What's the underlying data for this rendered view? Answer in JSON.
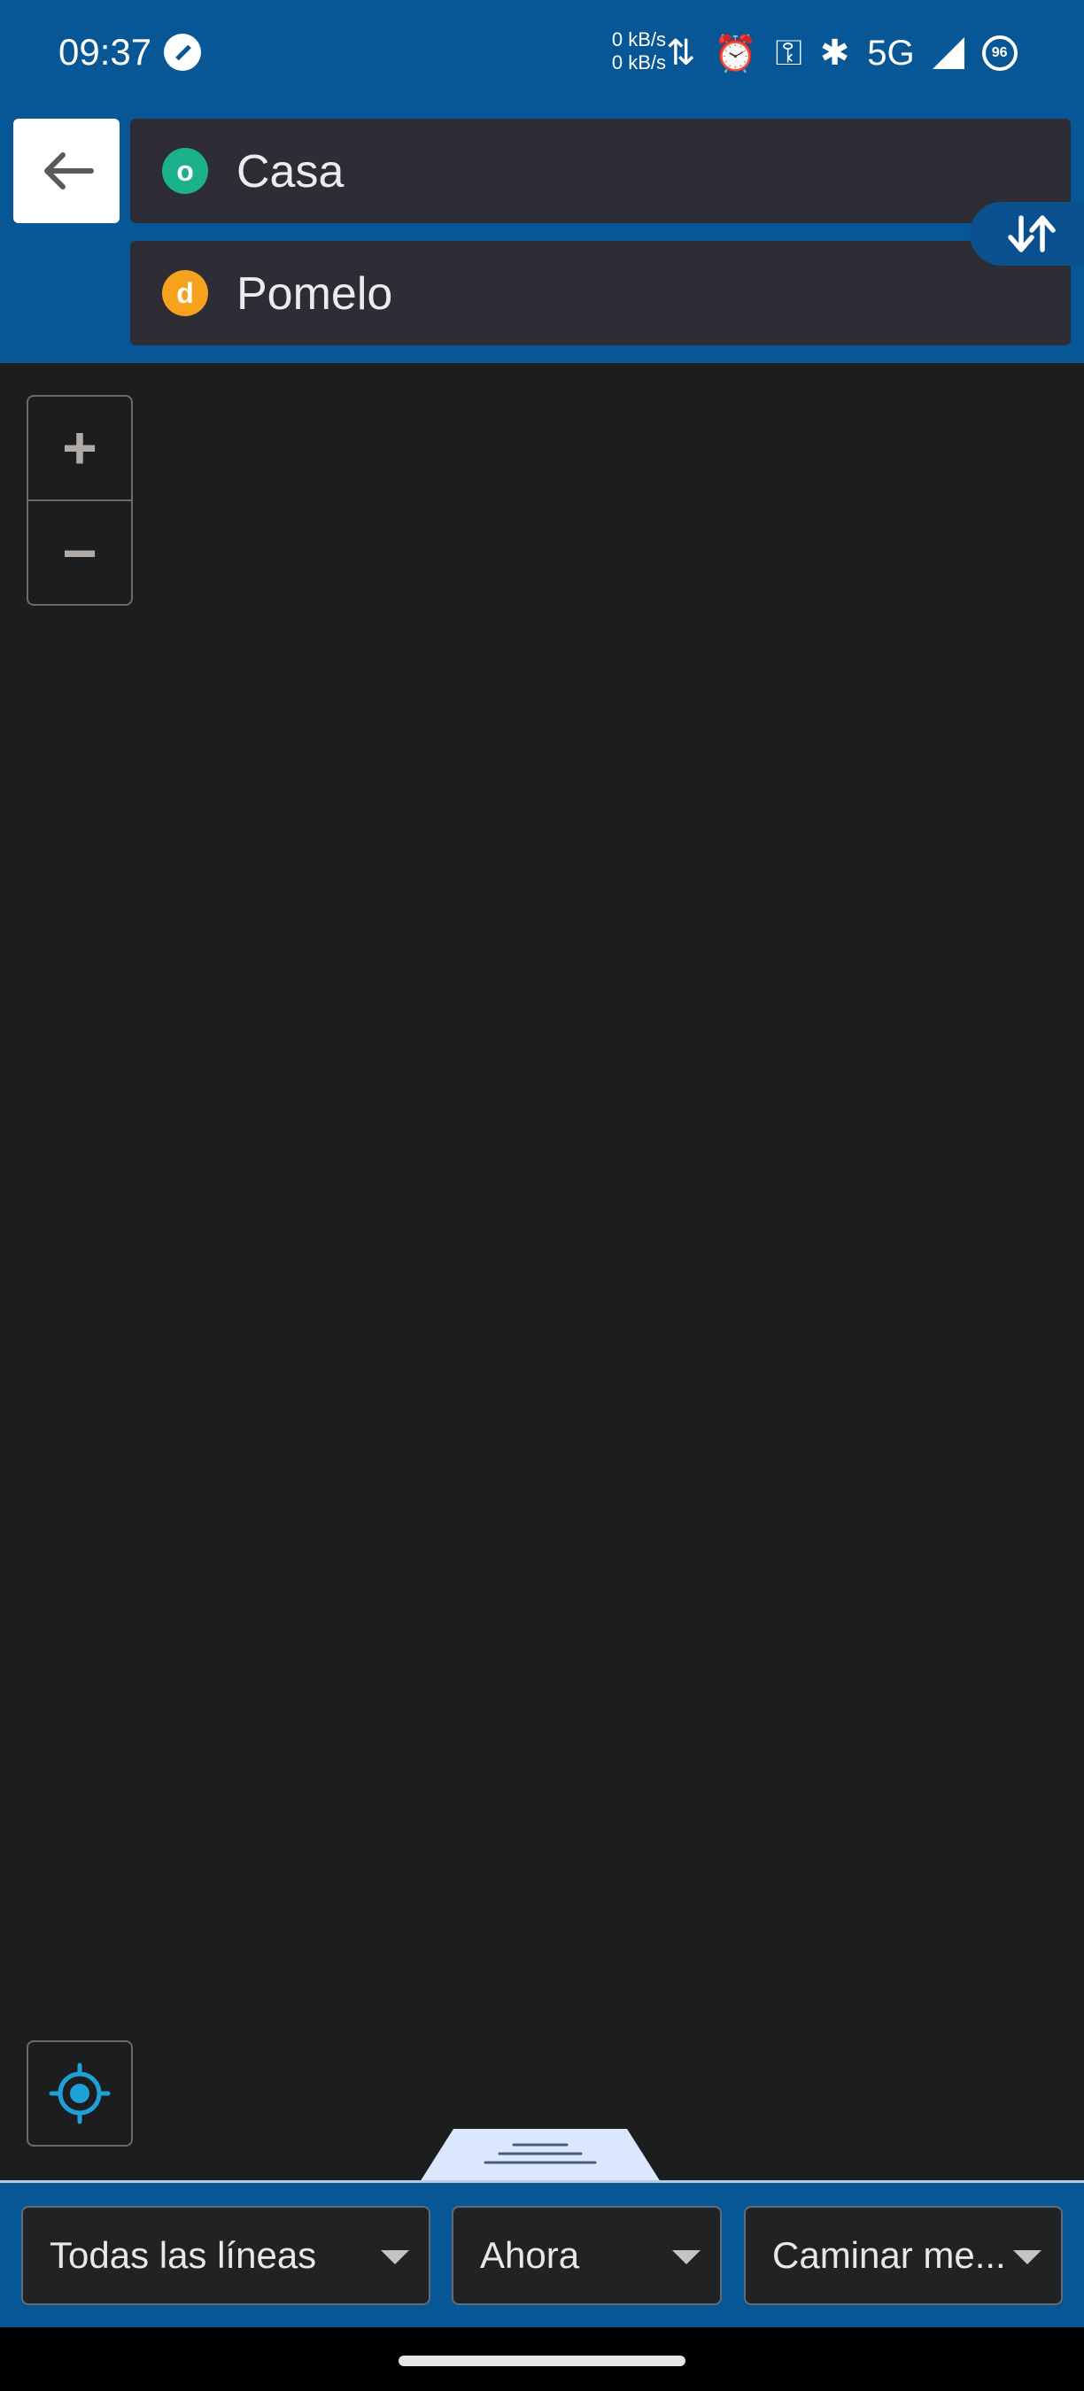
{
  "status_bar": {
    "time": "09:37",
    "net_up": "0 kB/s",
    "net_down": "0 kB/s",
    "network": "5G",
    "battery": "96"
  },
  "route": {
    "origin": {
      "marker": "o",
      "text": "Casa",
      "marker_color": "#1ab18c"
    },
    "destination": {
      "marker": "d",
      "text": "Pomelo",
      "marker_color": "#f7a21c"
    }
  },
  "map": {
    "zoom_in_label": "+",
    "zoom_out_label": "−"
  },
  "filters": {
    "lines": "Todas las líneas",
    "time": "Ahora",
    "walk": "Caminar me..."
  },
  "icons": {
    "back": "arrow-left-icon",
    "swap": "swap-vertical-icon",
    "locate": "my-location-icon",
    "drawer": "drawer-handle-icon"
  },
  "colors": {
    "primary": "#075796",
    "map_bg": "#1c1d1f",
    "field_bg": "#2e2d35",
    "locate_accent": "#1da1d6"
  }
}
